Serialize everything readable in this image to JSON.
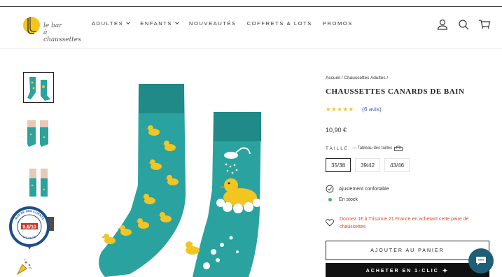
{
  "header": {
    "logo": {
      "line1": "le bar",
      "line2": "à chaussettes"
    },
    "nav": [
      {
        "label": "ADULTES",
        "dropdown": true
      },
      {
        "label": "ENFANTS",
        "dropdown": true
      },
      {
        "label": "NOUVEAUTÉS",
        "dropdown": false
      },
      {
        "label": "COFFRETS & LOTS",
        "dropdown": false
      },
      {
        "label": "PROMOS",
        "dropdown": false
      }
    ],
    "icons": [
      "account-icon",
      "search-icon",
      "cart-icon"
    ]
  },
  "gallery": {
    "thumbnail_count": 4,
    "active_index": 0
  },
  "badge": {
    "score": "9,6/10",
    "arc_top": "AVIS DE NOS CLIENTS",
    "arc_bottom": "GARANTIE"
  },
  "product": {
    "breadcrumb": "Accueil / Chaussettes Adultes /",
    "title": "CHAUSSETTES CANARDS DE BAIN",
    "rating_stars": 5,
    "reviews": "(6 avis)",
    "price": "10,90 €",
    "size_label": "TAILLE",
    "size_guide": "— Tableau des tailles",
    "sizes": [
      "35/38",
      "39/42",
      "43/46"
    ],
    "selected_size": "35/38",
    "features": [
      "Ajustement confortable",
      "En stock"
    ],
    "donation": "Donnez 1€ à Trisomie 21 France en achetant cette paire de chaussettes",
    "add_to_cart": "AJOUTER AU PANIER",
    "buy_now": "ACHETER EN 1-CLIC"
  },
  "colors": {
    "sock_teal": "#2aa3a0",
    "sock_dark": "#1f8a87",
    "duck_yellow": "#f3c522",
    "stars": "#f0c22b",
    "stock_green": "#43b357",
    "donation_red": "#d9482b",
    "chat_bg": "#1e5f78"
  }
}
